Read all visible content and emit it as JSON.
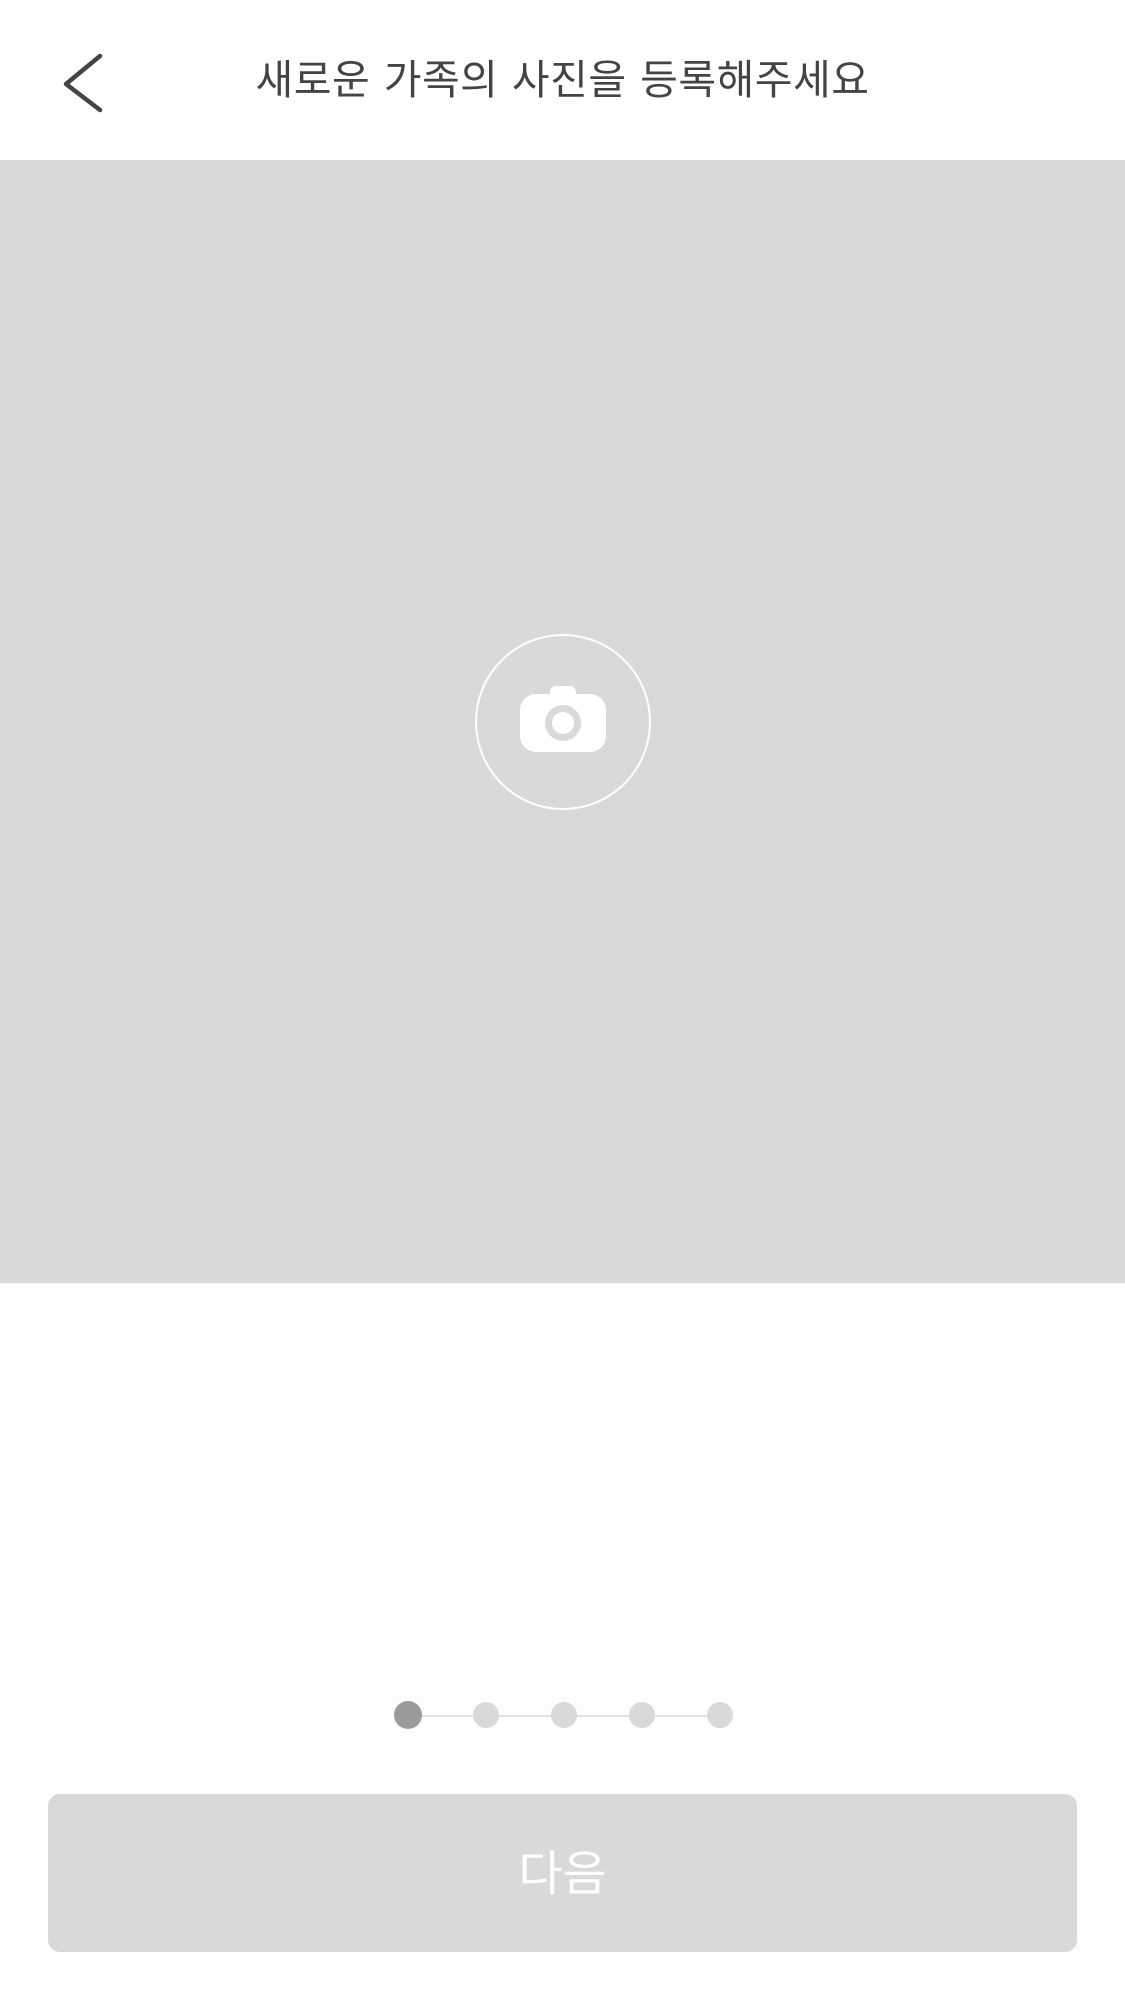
{
  "header": {
    "back_icon": "chevron-left-icon",
    "title": "새로운 가족의 사진을 등록해주세요"
  },
  "photo_area": {
    "camera_icon": "camera-icon",
    "colors": {
      "background": "#d9d9d9",
      "icon": "#ffffff"
    }
  },
  "stepper": {
    "total_steps": 5,
    "current_step": 1,
    "colors": {
      "active": "#9a9a9a",
      "inactive": "#d9d9d9"
    }
  },
  "footer": {
    "next_label": "다음",
    "button_color": "#d9d9d9"
  }
}
